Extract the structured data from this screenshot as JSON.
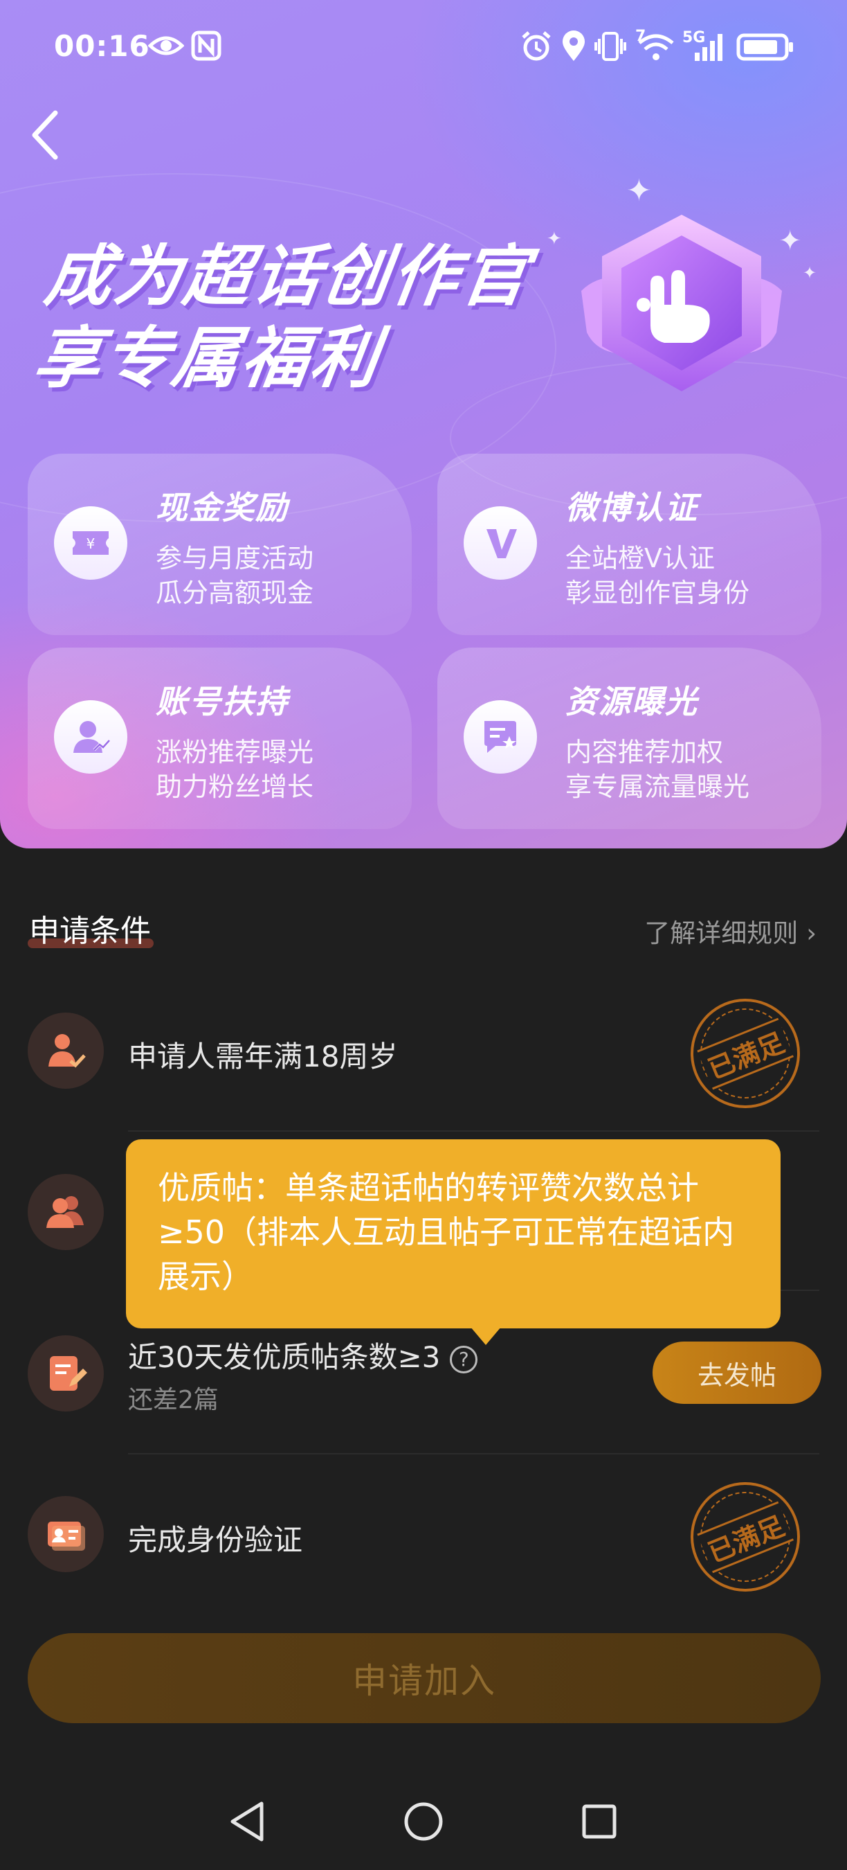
{
  "status_bar": {
    "time": "00:16",
    "network_label": "5G",
    "wifi_label": "7"
  },
  "hero": {
    "title_line1": "成为超话创作官",
    "title_line2": "享专属福利"
  },
  "benefits": [
    {
      "title": "现金奖励",
      "line1": "参与月度活动",
      "line2": "瓜分高额现金",
      "icon": "ticket-icon"
    },
    {
      "title": "微博认证",
      "line1": "全站橙V认证",
      "line2": "彰显创作官身份",
      "icon": "v-verified-icon"
    },
    {
      "title": "账号扶持",
      "line1": "涨粉推荐曝光",
      "line2": "助力粉丝增长",
      "icon": "user-growth-icon"
    },
    {
      "title": "资源曝光",
      "line1": "内容推荐加权",
      "line2": "享专属流量曝光",
      "icon": "content-star-icon"
    }
  ],
  "conditions": {
    "title": "申请条件",
    "rules_link": "了解详细规则",
    "items": [
      {
        "text": "申请人需年满18周岁",
        "stamp": "已满足"
      },
      {
        "text": "",
        "stamp": ""
      },
      {
        "text": "近30天发优质帖条数≥3",
        "sub": "还差2篇",
        "button": "去发帖"
      },
      {
        "text": "完成身份验证",
        "stamp": "已满足"
      }
    ]
  },
  "tooltip": {
    "text": "优质帖：单条超话帖的转评赞次数总计≥50（排本人互动且帖子可正常在超话内展示）"
  },
  "apply_button": "申请加入",
  "colors": {
    "accent_orange": "#f0af29",
    "stamp_brown": "#b86a1c",
    "background": "#1f1f1f"
  }
}
